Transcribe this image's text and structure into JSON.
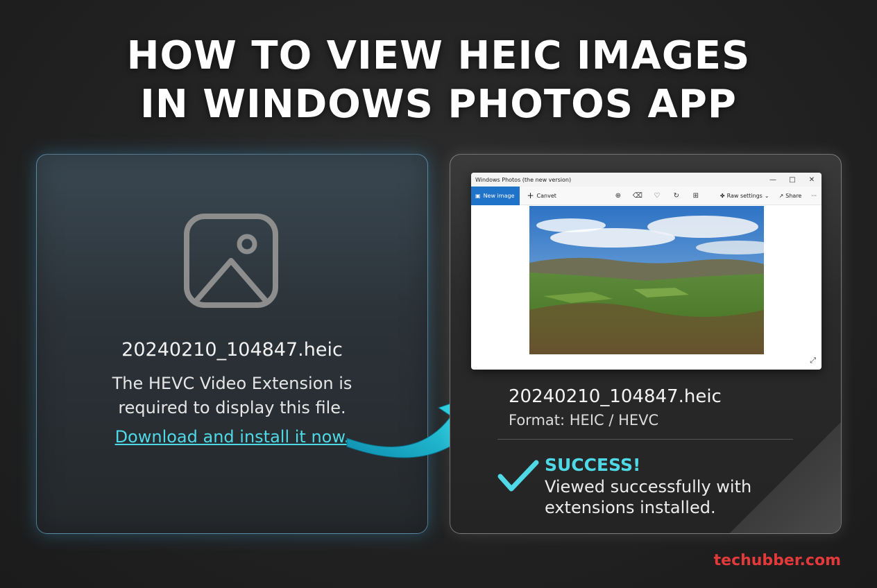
{
  "headline": {
    "line1": "HOW TO VIEW HEIC IMAGES",
    "line2": "IN WINDOWS PHOTOS APP"
  },
  "left_panel": {
    "icon": "broken-image-icon",
    "filename": "20240210_104847.heic",
    "message_line1": "The HEVC Video Extension is",
    "message_line2": "required to display this file.",
    "link_text": "Download and install it now."
  },
  "photos_window": {
    "title": "Windows Photos (the new version)",
    "new_image_label": "New image",
    "canvas_label": "Canvet",
    "raw_settings_label": "Raw settings",
    "share_label": "Share",
    "more_label": "···"
  },
  "right_panel": {
    "filename": "20240210_104847.heic",
    "format": "Format: HEIC / HEVC",
    "success_title": "SUCCESS!",
    "success_line1": "Viewed successfully with",
    "success_line2": "extensions installed."
  },
  "brand": "techubber.com",
  "colors": {
    "accent": "#4fd9e6",
    "brand": "#e23a3a",
    "photos_blue": "#1f73c8"
  }
}
